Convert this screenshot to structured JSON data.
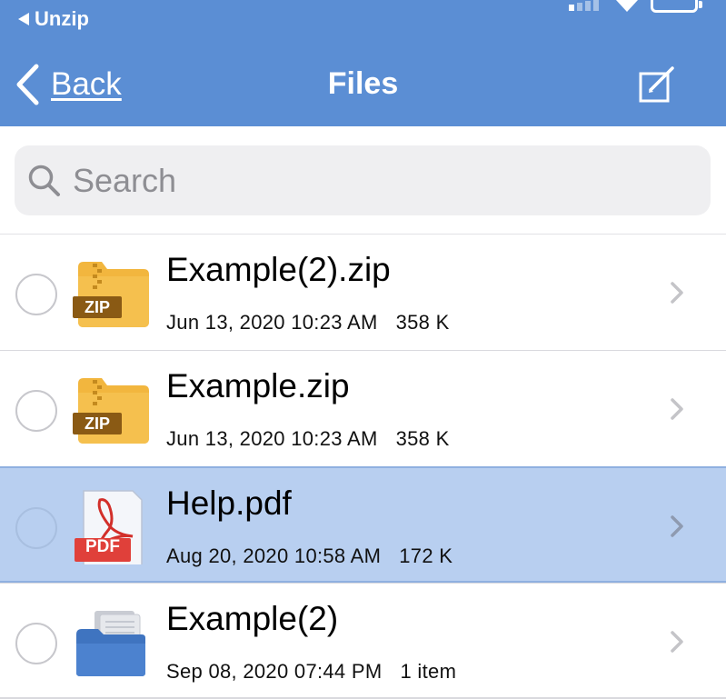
{
  "status_bar": {
    "back_app_label": "Unzip"
  },
  "nav": {
    "back_label": "Back",
    "title": "Files",
    "edit_icon": "compose-icon"
  },
  "search": {
    "placeholder": "Search",
    "value": ""
  },
  "colors": {
    "nav_bar": "#5b8ed4",
    "selected_row": "#b8cff0",
    "zip_folder": "#f2b63e",
    "pdf_badge": "#e0403a",
    "blue_folder": "#4c82cf"
  },
  "files": [
    {
      "name": "Example(2).zip",
      "date": "Jun 13, 2020 10:23 AM",
      "size": "358 K",
      "icon": "zip-folder-icon",
      "badge": "ZIP",
      "selected": false
    },
    {
      "name": "Example.zip",
      "date": "Jun 13, 2020 10:23 AM",
      "size": "358 K",
      "icon": "zip-folder-icon",
      "badge": "ZIP",
      "selected": false
    },
    {
      "name": "Help.pdf",
      "date": "Aug 20, 2020 10:58 AM",
      "size": "172 K",
      "icon": "pdf-file-icon",
      "badge": "PDF",
      "selected": true
    },
    {
      "name": "Example(2)",
      "date": "Sep 08, 2020 07:44 PM",
      "size": "1 item",
      "icon": "folder-icon",
      "badge": "",
      "selected": false
    }
  ]
}
